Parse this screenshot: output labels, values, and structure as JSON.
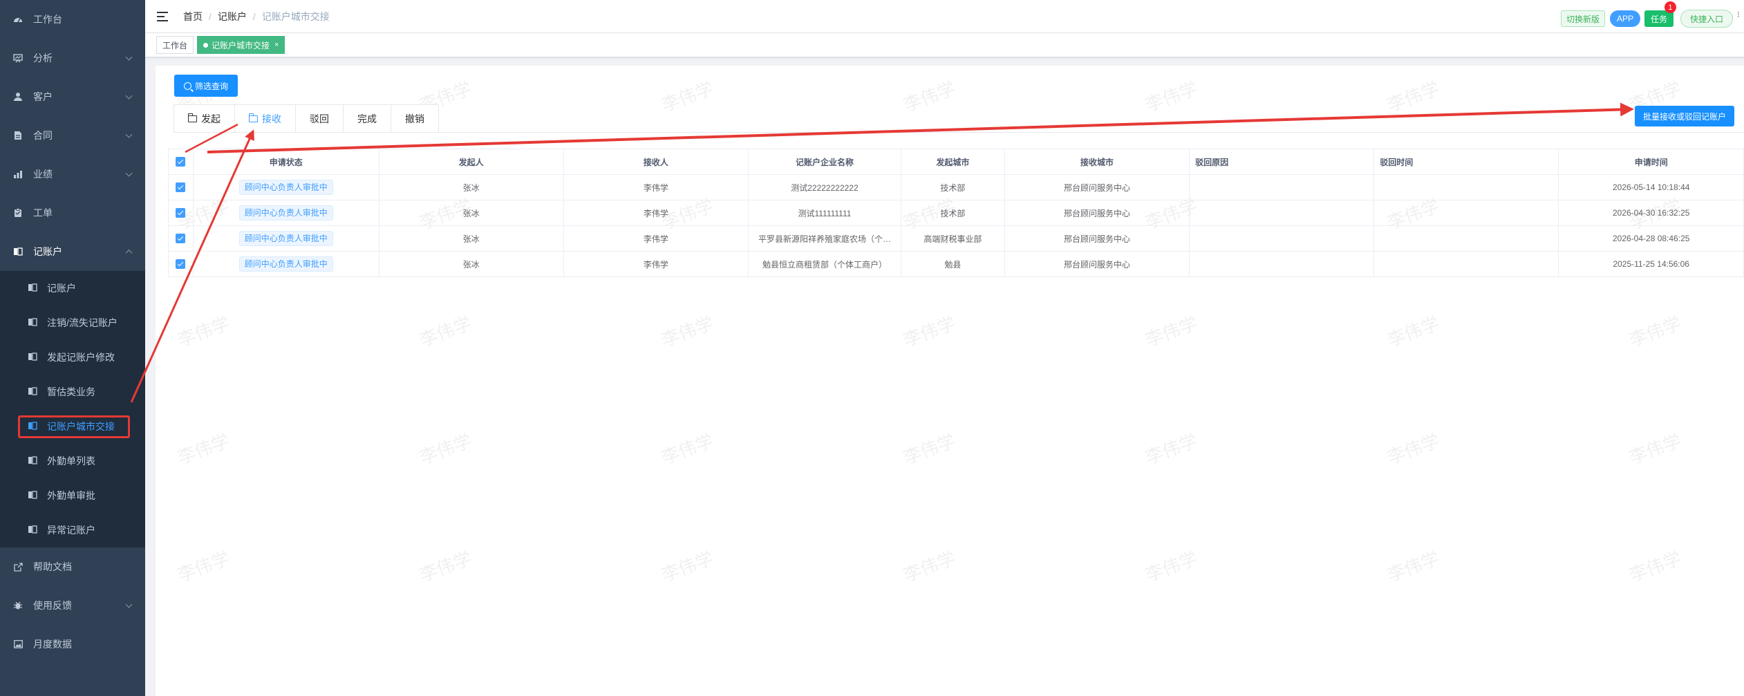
{
  "sidebar": {
    "items": [
      {
        "label": "工作台",
        "icon": "dashboard-icon",
        "has_chevron": false
      },
      {
        "label": "分析",
        "icon": "chart-icon",
        "has_chevron": true
      },
      {
        "label": "客户",
        "icon": "user-icon",
        "has_chevron": true
      },
      {
        "label": "合同",
        "icon": "document-icon",
        "has_chevron": true
      },
      {
        "label": "业绩",
        "icon": "bar-chart-icon",
        "has_chevron": true
      },
      {
        "label": "工单",
        "icon": "clipboard-icon",
        "has_chevron": false
      },
      {
        "label": "记账户",
        "icon": "ledger-icon",
        "has_chevron": true,
        "open": true
      }
    ],
    "submenu": [
      {
        "label": "记账户"
      },
      {
        "label": "注销/流失记账户"
      },
      {
        "label": "发起记账户修改"
      },
      {
        "label": "暂估类业务"
      },
      {
        "label": "记账户城市交接",
        "active": true
      },
      {
        "label": "外勤单列表"
      },
      {
        "label": "外勤单审批"
      },
      {
        "label": "异常记账户"
      }
    ],
    "bottom_items": [
      {
        "label": "帮助文档",
        "icon": "external-link-icon",
        "has_chevron": false
      },
      {
        "label": "使用反馈",
        "icon": "bug-icon",
        "has_chevron": true
      },
      {
        "label": "月度数据",
        "icon": "image-icon",
        "has_chevron": false
      }
    ]
  },
  "header": {
    "breadcrumb": [
      "首页",
      "记账户",
      "记账户城市交接"
    ],
    "switch_label": "切换新版",
    "app_label": "APP",
    "task_label": "任务",
    "task_badge": "1",
    "quick_label": "快捷入口"
  },
  "tags": {
    "home": "工作台",
    "current": "记账户城市交接",
    "close": "×"
  },
  "toolbar": {
    "filter_label": "筛选查询",
    "batch_label": "批量接收或驳回记账户"
  },
  "tabs": [
    {
      "label": "发起",
      "folder_icon": true
    },
    {
      "label": "接收",
      "folder_icon": true,
      "active": true
    },
    {
      "label": "驳回"
    },
    {
      "label": "完成"
    },
    {
      "label": "撤销"
    }
  ],
  "table": {
    "columns": [
      "申请状态",
      "发起人",
      "接收人",
      "记账户企业名称",
      "发起城市",
      "接收城市",
      "驳回原因",
      "驳回时间",
      "申请时间"
    ],
    "rows": [
      {
        "status": "顾问中心负责人审批中",
        "initiator": "张冰",
        "receiver": "李伟学",
        "company": "测试22222222222",
        "from_city": "技术部",
        "to_city": "邢台顾问服务中心",
        "reject_reason": "",
        "reject_time": "",
        "apply_time": "2026-05-14 10:18:44"
      },
      {
        "status": "顾问中心负责人审批中",
        "initiator": "张冰",
        "receiver": "李伟学",
        "company": "测试111111111",
        "from_city": "技术部",
        "to_city": "邢台顾问服务中心",
        "reject_reason": "",
        "reject_time": "",
        "apply_time": "2026-04-30 16:32:25"
      },
      {
        "status": "顾问中心负责人审批中",
        "initiator": "张冰",
        "receiver": "李伟学",
        "company": "平罗县新源阳祥养殖家庭农场（个…",
        "from_city": "高端财税事业部",
        "to_city": "邢台顾问服务中心",
        "reject_reason": "",
        "reject_time": "",
        "apply_time": "2026-04-28 08:46:25"
      },
      {
        "status": "顾问中心负责人审批中",
        "initiator": "张冰",
        "receiver": "李伟学",
        "company": "勉县恒立商租赁部（个体工商户）",
        "from_city": "勉县",
        "to_city": "邢台顾问服务中心",
        "reject_reason": "",
        "reject_time": "",
        "apply_time": "2025-11-25 14:56:06"
      }
    ]
  },
  "watermark_text": "李伟学",
  "colors": {
    "sidebar_bg": "#304156",
    "submenu_bg": "#1f2d3d",
    "primary": "#1890ff",
    "active_tag": "#42b983",
    "annotation_red": "#e53935"
  }
}
